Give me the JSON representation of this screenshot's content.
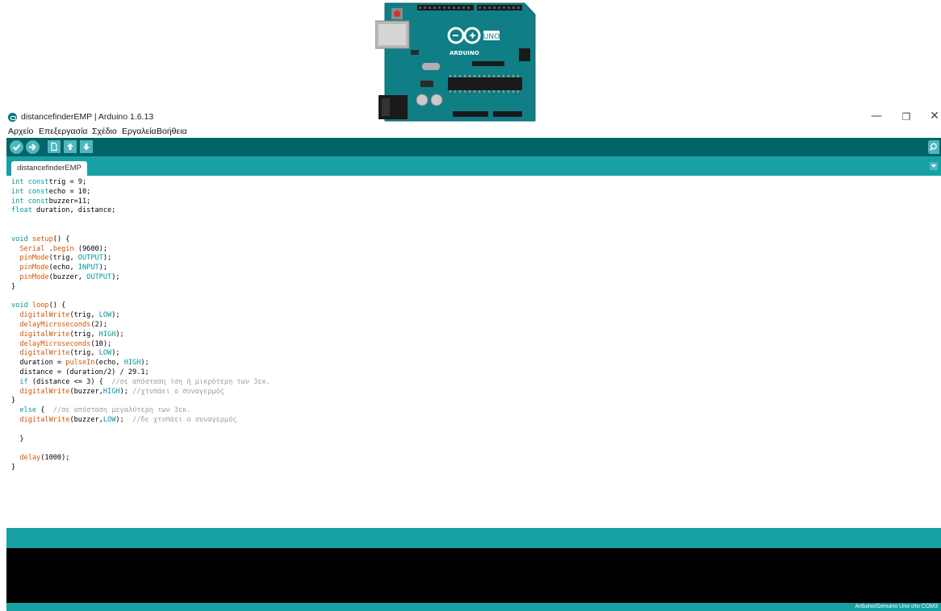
{
  "window": {
    "title": "distancefinderEMP | Arduino 1.6.13",
    "minimize": "—",
    "maximize": "❐",
    "close": "✕"
  },
  "menu": [
    "Αρχείο",
    "Επεξεργασία",
    "Σχέδιο",
    "Εργαλεία",
    "Βοήθεια"
  ],
  "board_image": {
    "logo_text": "UNO",
    "brand_text": "ARDUINO"
  },
  "toolbar": {
    "icons": [
      "verify-icon",
      "upload-icon",
      "new-icon",
      "open-icon",
      "save-icon",
      "serial-monitor-icon"
    ]
  },
  "tabs": [
    {
      "label": "distancefinderEMP"
    }
  ],
  "code": [
    [
      [
        "kw",
        "int const"
      ],
      [
        "",
        "trig = 9;"
      ]
    ],
    [
      [
        "kw",
        "int const"
      ],
      [
        "",
        "echo = 10;"
      ]
    ],
    [
      [
        "kw",
        "int const"
      ],
      [
        "",
        "buzzer=11;"
      ]
    ],
    [
      [
        "kw",
        "float"
      ],
      [
        "",
        " duration, distance;"
      ]
    ],
    [],
    [],
    [
      [
        "kw",
        "void"
      ],
      [
        "",
        " "
      ],
      [
        "fn",
        "setup"
      ],
      [
        "",
        "() {"
      ]
    ],
    [
      [
        "",
        "  "
      ],
      [
        "fn",
        "Serial"
      ],
      [
        "",
        " ."
      ],
      [
        "fn",
        "begin"
      ],
      [
        "",
        " (9600);"
      ]
    ],
    [
      [
        "",
        "  "
      ],
      [
        "fn",
        "pinMode"
      ],
      [
        "",
        "(trig, "
      ],
      [
        "kw",
        "OUTPUT"
      ],
      [
        "",
        ");"
      ]
    ],
    [
      [
        "",
        "  "
      ],
      [
        "fn",
        "pinMode"
      ],
      [
        "",
        "(echo, "
      ],
      [
        "kw",
        "INPUT"
      ],
      [
        "",
        ");"
      ]
    ],
    [
      [
        "",
        "  "
      ],
      [
        "fn",
        "pinMode"
      ],
      [
        "",
        "(buzzer, "
      ],
      [
        "kw",
        "OUTPUT"
      ],
      [
        "",
        ");"
      ]
    ],
    [
      [
        "",
        "}"
      ]
    ],
    [],
    [
      [
        "kw",
        "void"
      ],
      [
        "",
        " "
      ],
      [
        "fn",
        "loop"
      ],
      [
        "",
        "() {"
      ]
    ],
    [
      [
        "",
        "  "
      ],
      [
        "fn",
        "digitalWrite"
      ],
      [
        "",
        "(trig, "
      ],
      [
        "kw",
        "LOW"
      ],
      [
        "",
        ");"
      ]
    ],
    [
      [
        "",
        "  "
      ],
      [
        "fn",
        "delayMicroseconds"
      ],
      [
        "",
        "(2);"
      ]
    ],
    [
      [
        "",
        "  "
      ],
      [
        "fn",
        "digitalWrite"
      ],
      [
        "",
        "(trig, "
      ],
      [
        "kw",
        "HIGH"
      ],
      [
        "",
        ");"
      ]
    ],
    [
      [
        "",
        "  "
      ],
      [
        "fn",
        "delayMicroseconds"
      ],
      [
        "",
        "(10);"
      ]
    ],
    [
      [
        "",
        "  "
      ],
      [
        "fn",
        "digitalWrite"
      ],
      [
        "",
        "(trig, "
      ],
      [
        "kw",
        "LOW"
      ],
      [
        "",
        ");"
      ]
    ],
    [
      [
        "",
        "  duration = "
      ],
      [
        "fn",
        "pulseIn"
      ],
      [
        "",
        "(echo, "
      ],
      [
        "kw",
        "HIGH"
      ],
      [
        "",
        ");"
      ]
    ],
    [
      [
        "",
        "  distance = (duration/2) / 29.1;"
      ]
    ],
    [
      [
        "",
        "  "
      ],
      [
        "kw",
        "if"
      ],
      [
        "",
        " (distance <= 3) {  "
      ],
      [
        "cm",
        "//σε απόσταση ίση ή μικρότερη των 3εκ."
      ]
    ],
    [
      [
        "",
        "  "
      ],
      [
        "fn",
        "digitalWrite"
      ],
      [
        "",
        "(buzzer,"
      ],
      [
        "kw",
        "HIGH"
      ],
      [
        "",
        "); "
      ],
      [
        "cm",
        "//χτυπάει ο συναγερμός"
      ]
    ],
    [
      [
        "",
        "}"
      ]
    ],
    [
      [
        "",
        "  "
      ],
      [
        "kw",
        "else"
      ],
      [
        "",
        " {  "
      ],
      [
        "cm",
        "//σε απόσταση μεγαλύτερη των 3εκ."
      ]
    ],
    [
      [
        "",
        "  "
      ],
      [
        "fn",
        "digitalWrite"
      ],
      [
        "",
        "(buzzer,"
      ],
      [
        "kw",
        "LOW"
      ],
      [
        "",
        "); "
      ],
      [
        "cm",
        " //δε χτυπάει ο συναγερμός"
      ]
    ],
    [],
    [
      [
        "",
        "  }"
      ]
    ],
    [],
    [
      [
        "",
        "  "
      ],
      [
        "fn",
        "delay"
      ],
      [
        "",
        "(1000);"
      ]
    ],
    [
      [
        "",
        "}"
      ]
    ]
  ],
  "status": {
    "board_info": "Arduino/Genuino Uno στο COM3"
  },
  "colors": {
    "toolbar": "#006468",
    "tabbar": "#17a1a5",
    "button": "#4db7bb",
    "keyword": "#00979c",
    "function": "#d35400",
    "comment": "#95a5a6",
    "console": "#000000"
  }
}
